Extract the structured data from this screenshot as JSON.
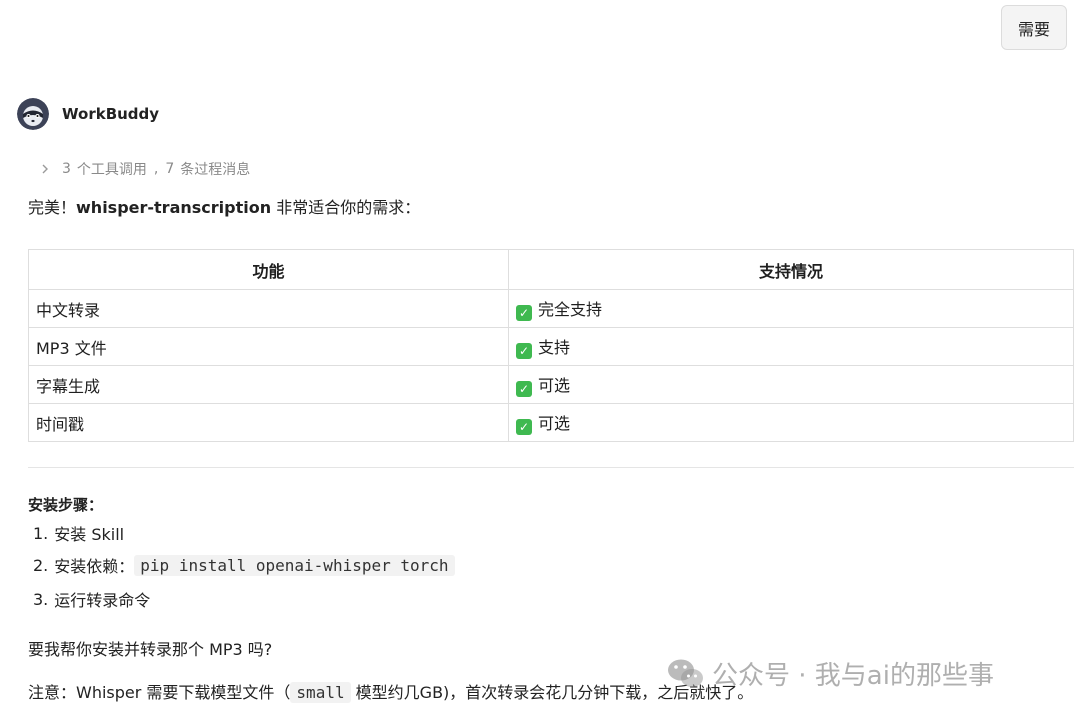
{
  "user_message": "需要",
  "bot": {
    "name": "WorkBuddy",
    "avatar_icon": "raccoon-avatar-icon"
  },
  "tool_summary": {
    "tool_count": "3",
    "tool_label": "个工具调用",
    "separator": ",",
    "process_count": "7",
    "process_label": "条过程消息"
  },
  "intro": {
    "prefix": "完美！",
    "skill_name": "whisper-transcription",
    "suffix": " 非常适合你的需求："
  },
  "table": {
    "headers": [
      "功能",
      "支持情况"
    ],
    "rows": [
      {
        "feature": "中文转录",
        "status": "完全支持"
      },
      {
        "feature": "MP3 文件",
        "status": "支持"
      },
      {
        "feature": "字幕生成",
        "status": "可选"
      },
      {
        "feature": "时间戳",
        "status": "可选"
      }
    ],
    "check_glyph": "✓",
    "check_color": "#3fb950"
  },
  "steps": {
    "title": "安装步骤：",
    "items": [
      {
        "num": "1.",
        "text": "安装 Skill"
      },
      {
        "num": "2.",
        "text": "安装依赖：",
        "code": "pip install openai-whisper torch"
      },
      {
        "num": "3.",
        "text": "运行转录命令"
      }
    ]
  },
  "question": "要我帮你安装并转录那个 MP3 吗?",
  "note": {
    "prefix": "注意：Whisper 需要下载模型文件（",
    "code": "small",
    "suffix": " 模型约几GB)，首次转录会花几分钟下载，之后就快了。"
  },
  "watermark": {
    "text": "公众号 · 我与ai的那些事",
    "icon": "wechat-icon"
  }
}
